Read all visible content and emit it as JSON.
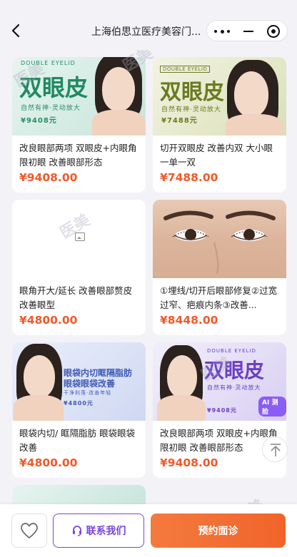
{
  "header": {
    "title": "上海伯思立医疗美容门...",
    "back_icon": "chevron-left-icon",
    "more_icon": "more-dots-icon",
    "minimize_icon": "minus-icon",
    "close_icon": "target-circle-icon"
  },
  "products": [
    {
      "title": "改良眼部两项 双眼皮+内眼角限初眼 改善眼部形态",
      "price": "¥9408.00",
      "poster": {
        "headline": "双眼皮",
        "tag": "DOUBLE EYELID",
        "sub": "自然有神·灵动放大",
        "price": "¥9408元",
        "theme": "#1f8a63"
      }
    },
    {
      "title": "切开双眼皮 改善内双 大小眼一单一双",
      "price": "¥7488.00",
      "poster": {
        "headline": "双眼皮",
        "tag": "DOUBLE EYELID",
        "sub": "自然有神·灵动放大",
        "price": "¥7488元",
        "theme": "#6b7a21"
      }
    },
    {
      "title": "眼角开大/延长 改善眼部赘皮 改善眼型",
      "price": "¥4800.00",
      "poster": {
        "placeholder_icon": "image-placeholder-icon"
      }
    },
    {
      "title": "①埋线/切开后眼部修复②过宽过窄、疤痕内条③改善...",
      "price": "¥8448.00",
      "poster": {
        "kind": "eyes-closeup"
      }
    },
    {
      "title": "眼袋内切/ 眶隔脂肪 眼袋眼袋改善",
      "price": "¥4800.00",
      "poster": {
        "headline": "眼袋内切眶隔脂肪",
        "headline2": "眼袋眼袋改善",
        "sub": "干净利落·改善年轻",
        "price": "¥4800元",
        "theme": "#3f5bb5"
      }
    },
    {
      "title": "改良眼部两项 双眼皮+内眼角限初眼 改善眼部形态",
      "price": "¥9408.00",
      "poster": {
        "headline": "双眼皮",
        "tag": "DOUBLE EYELID",
        "sub": "自然有神·灵动放大",
        "price": "¥9408元",
        "ai": "AI 测脸",
        "theme": "#6a3fc4"
      }
    }
  ],
  "watermark": "医美",
  "bottom": {
    "favorite_icon": "heart-icon",
    "contact_label": "联系我们",
    "contact_icon": "headset-icon",
    "book_label": "预约面诊"
  },
  "colors": {
    "price": "#f05a2a",
    "accent_purple": "#7b45d6",
    "book_orange": "#f0642a"
  }
}
